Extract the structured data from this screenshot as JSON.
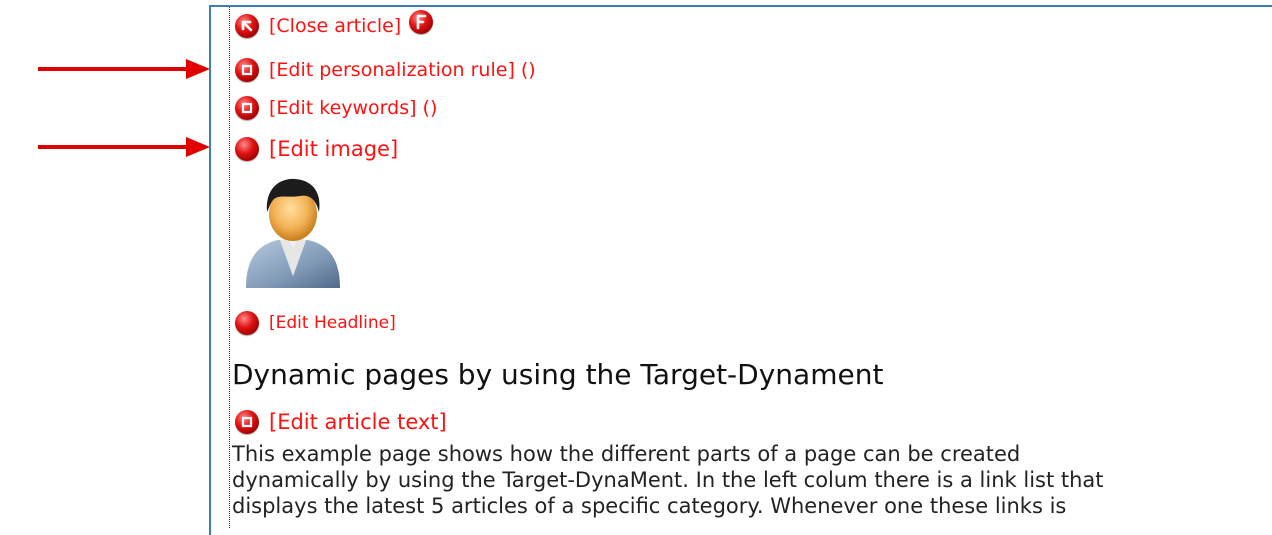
{
  "links": {
    "close_article": "[Close article]",
    "edit_personalization": "[Edit personalization rule] ()",
    "edit_keywords": "[Edit keywords] ()",
    "edit_image": "[Edit image]",
    "edit_headline": "[Edit Headline]",
    "edit_article_text": "[Edit article text]"
  },
  "headline": "Dynamic pages by using the Target-Dynament",
  "article_lines": [
    "This example page shows how the different parts of a page can be created",
    "dynamically by using the Target-DynaMent. In the left colum there is a link list that",
    "displays the latest 5 articles of a specific category. Whenever one these links is"
  ],
  "icons": {
    "close": "up-left-arrow-icon",
    "f_badge": "f-letter-icon",
    "edit": "edit-ball-icon",
    "user_image": "user-avatar-icon",
    "annotation_arrow": "red-arrow-icon"
  },
  "colors": {
    "link": "#ff1111",
    "frame_border": "#3c7fb1",
    "arrow": "#e00000"
  }
}
